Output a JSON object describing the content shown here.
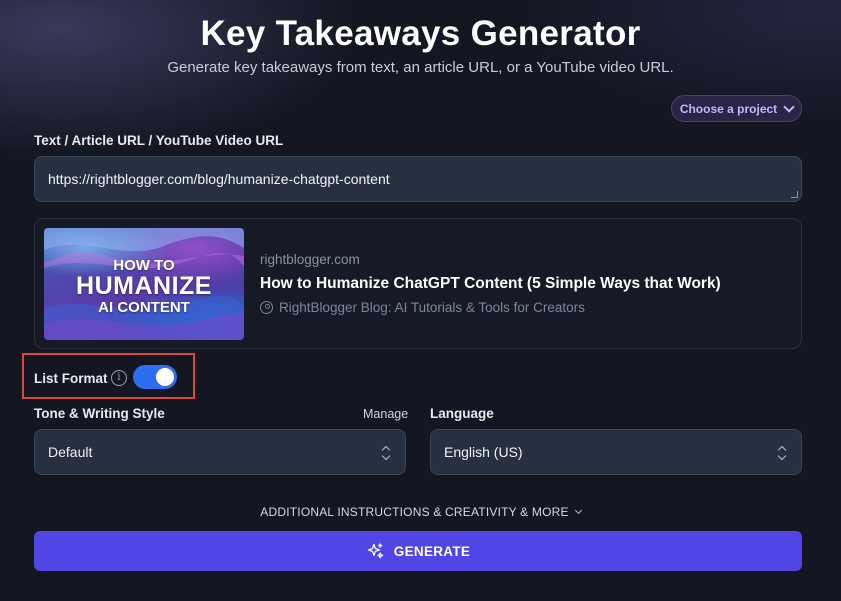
{
  "header": {
    "title": "Key Takeaways Generator",
    "subtitle": "Generate key takeaways from text, an article URL, or a YouTube video URL."
  },
  "project_selector": {
    "label": "Choose a project"
  },
  "input": {
    "label": "Text / Article URL / YouTube Video URL",
    "value": "https://rightblogger.com/blog/humanize-chatgpt-content"
  },
  "preview": {
    "thumbnail_text": [
      "HOW TO",
      "HUMANIZE",
      "AI CONTENT"
    ],
    "site": "rightblogger.com",
    "title": "How to Humanize ChatGPT Content (5 Simple Ways that Work)",
    "author": "RightBlogger Blog: AI Tutorials & Tools for Creators"
  },
  "list_format": {
    "label": "List Format",
    "enabled": true,
    "info_glyph": "i"
  },
  "tone": {
    "label": "Tone & Writing Style",
    "manage_label": "Manage",
    "value": "Default"
  },
  "language": {
    "label": "Language",
    "value": "English (US)"
  },
  "additional": {
    "label": "ADDITIONAL INSTRUCTIONS & CREATIVITY & MORE"
  },
  "generate": {
    "label": "GENERATE"
  },
  "colors": {
    "background": "#141722",
    "accent": "#4f46e5",
    "toggle": "#2d6ef0",
    "highlight": "#e0443e",
    "project_text": "#c4b5fd"
  },
  "icons": {
    "project_chevron": "chevron-down-icon",
    "info": "info-icon",
    "author": "user-circle-icon",
    "select_arrows": "chevron-updown-icon",
    "generate": "sparkles-icon"
  }
}
